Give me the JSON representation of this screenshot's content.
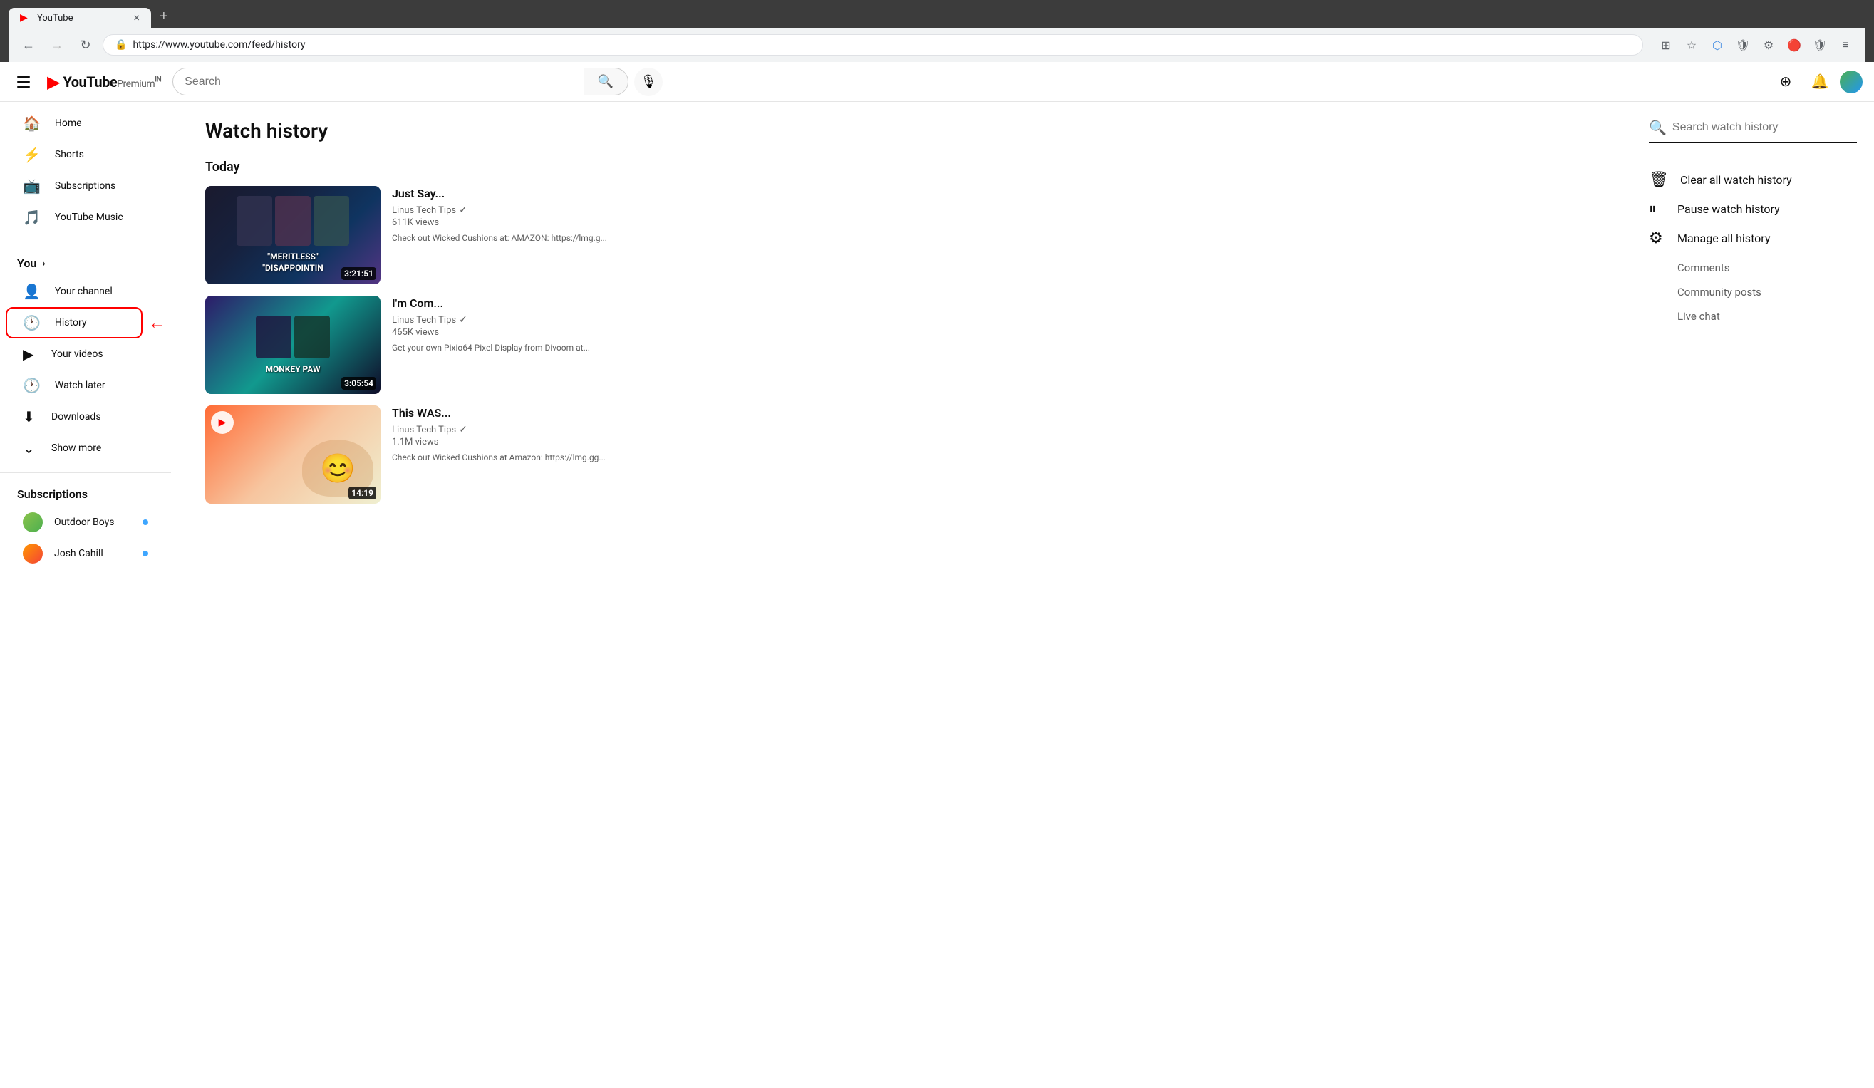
{
  "browser": {
    "tab_title": "YouTube",
    "tab_favicon": "▶",
    "url": "https://www.youtube.com/feed/history",
    "new_tab_label": "+",
    "nav": {
      "back_title": "Back",
      "forward_title": "Forward",
      "refresh_title": "Refresh"
    }
  },
  "header": {
    "hamburger_label": "Menu",
    "logo_icon": "▶",
    "logo_text": "YouTube",
    "logo_premium": "Premium",
    "logo_in": "IN",
    "search_placeholder": "Search",
    "search_btn_label": "Search",
    "mic_label": "Voice search",
    "create_label": "Create",
    "notifications_label": "Notifications",
    "account_label": "Account"
  },
  "sidebar": {
    "items": [
      {
        "id": "home",
        "label": "Home",
        "icon": "🏠"
      },
      {
        "id": "shorts",
        "label": "Shorts",
        "icon": "⚡"
      },
      {
        "id": "subscriptions",
        "label": "Subscriptions",
        "icon": "📺"
      },
      {
        "id": "youtube-music",
        "label": "YouTube Music",
        "icon": "🎵"
      }
    ],
    "you_label": "You",
    "you_items": [
      {
        "id": "your-channel",
        "label": "Your channel",
        "icon": "👤"
      },
      {
        "id": "history",
        "label": "History",
        "icon": "🕐",
        "active": true
      },
      {
        "id": "your-videos",
        "label": "Your videos",
        "icon": "▶"
      },
      {
        "id": "watch-later",
        "label": "Watch later",
        "icon": "🕐"
      },
      {
        "id": "downloads",
        "label": "Downloads",
        "icon": "⬇"
      },
      {
        "id": "show-more",
        "label": "Show more",
        "icon": "⌄"
      }
    ],
    "subscriptions_label": "Subscriptions",
    "subscriptions": [
      {
        "id": "outdoor-boys",
        "label": "Outdoor Boys",
        "has_dot": true
      },
      {
        "id": "josh-cahill",
        "label": "Josh Cahill",
        "has_dot": true
      }
    ]
  },
  "main": {
    "page_title": "Watch history",
    "today_label": "Today",
    "videos": [
      {
        "id": "video-1",
        "title": "Just Say...",
        "channel": "Linus Tech Tips",
        "views": "611K views",
        "description": "Check out Wicked Cushions at: AMAZON: https://lmg.g...",
        "duration": "3:21:51",
        "thumb_class": "thumb-1",
        "thumb_text": "\"MERITLESS\"\n\"DISAPPOINTIN"
      },
      {
        "id": "video-2",
        "title": "I'm Com...",
        "channel": "Linus Tech Tips",
        "views": "465K views",
        "description": "Get your own Pixio64 Pixel Display from Divoom at...",
        "duration": "3:05:54",
        "thumb_class": "thumb-2",
        "thumb_text": "MONKEY PAW"
      },
      {
        "id": "video-3",
        "title": "This WAS...",
        "channel": "Linus Tech Tips",
        "views": "1.1M views",
        "description": "Check out Wicked Cushions at Amazon: https://lmg.gg...",
        "duration": "14:19",
        "thumb_class": "thumb-3",
        "has_play_indicator": true
      }
    ]
  },
  "right_panel": {
    "search_placeholder": "Search watch history",
    "clear_label": "Clear all watch history",
    "pause_label": "Pause watch history",
    "manage_label": "Manage all history",
    "sub_actions": [
      {
        "id": "comments",
        "label": "Comments"
      },
      {
        "id": "community-posts",
        "label": "Community posts"
      },
      {
        "id": "live-chat",
        "label": "Live chat"
      }
    ]
  }
}
